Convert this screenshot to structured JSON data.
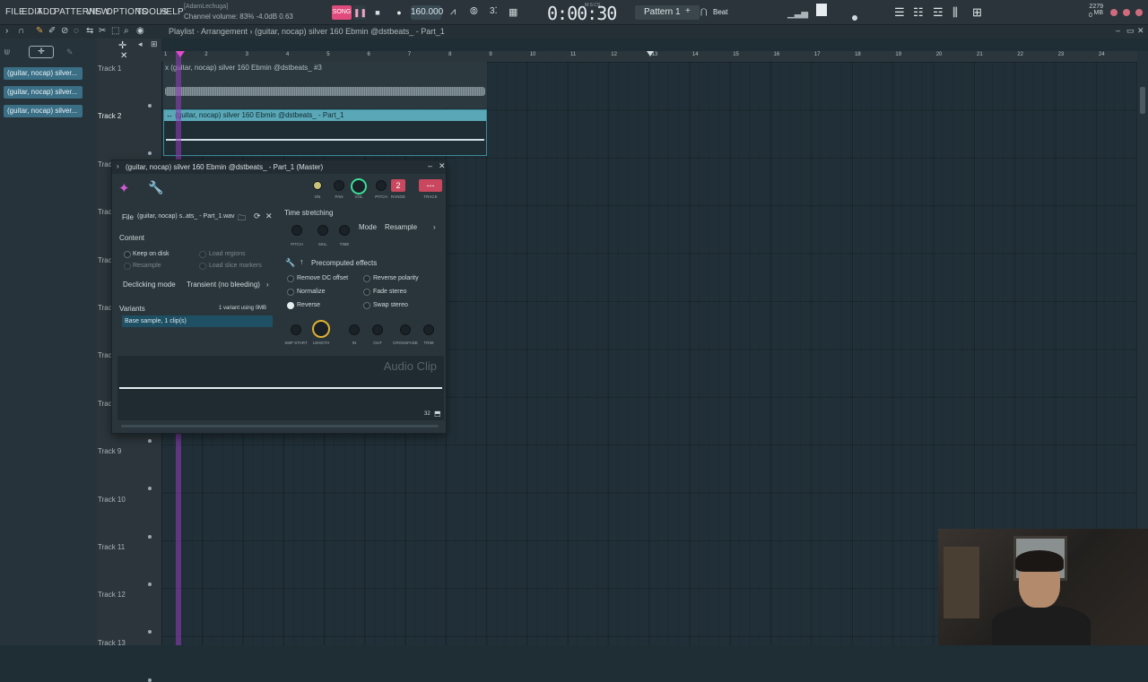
{
  "menu": [
    "FILE",
    "EDIT",
    "ADD",
    "PATTERNS",
    "VIEW",
    "OPTIONS",
    "TOOLS",
    "HELP"
  ],
  "hint": {
    "user": "[AdamLechuga]",
    "line": "Channel volume: 83%  -4.0dB  0.63"
  },
  "transport": {
    "song_label": "SONG",
    "tempo": "160.000",
    "time": "0:00:30",
    "time_unit": "M:S:CS",
    "pattern": "Pattern 1",
    "snap": "Beat"
  },
  "memory": {
    "mb": "2279 MB",
    "cpu": "0"
  },
  "breadcrumb": "Playlist · Arrangement › (guitar, nocap) silver 160 Ebmin @dstbeats_ - Part_1",
  "browser_items": [
    "(guitar, nocap) silver...",
    "(guitar, nocap) silver...",
    "(guitar, nocap) silver..."
  ],
  "tracks": [
    {
      "label": "Track 1"
    },
    {
      "label": "Track 2"
    },
    {
      "label": "Track 3"
    },
    {
      "label": "Track 4"
    },
    {
      "label": "Track 5"
    },
    {
      "label": "Track 6"
    },
    {
      "label": "Track 7"
    },
    {
      "label": "Track 8"
    },
    {
      "label": "Track 9"
    },
    {
      "label": "Track 10"
    },
    {
      "label": "Track 11"
    },
    {
      "label": "Track 12"
    },
    {
      "label": "Track 13"
    }
  ],
  "ruler_ticks": [
    "1",
    "2",
    "3",
    "4",
    "5",
    "6",
    "7",
    "8",
    "9",
    "10",
    "11",
    "12",
    "13",
    "14",
    "15",
    "16",
    "17",
    "18",
    "19",
    "20",
    "21",
    "22",
    "23",
    "24"
  ],
  "clips": {
    "clip1_title": "x (guitar, nocap) silver 160 Ebmin @dstbeats_ #3",
    "clip2_title": "↔ (guitar, nocap) silver 160 Ebmin @dstbeats_ - Part_1"
  },
  "channel": {
    "title": "(guitar, nocap) silver 160 Ebmin @dstbeats_ - Part_1 (Master)",
    "knobs": {
      "on": "ON",
      "pan": "PAN",
      "vol": "VOL",
      "pitch": "PITCH",
      "range": "RANGE",
      "range_value": "2",
      "track": "TRACK",
      "track_value": "---"
    },
    "file_label": "File",
    "file_name": "(guitar, nocap) s..ats_ - Part_1.wav",
    "content_label": "Content",
    "keep_on_disk": "Keep on disk",
    "resample": "Resample",
    "load_regions": "Load regions",
    "load_slice_markers": "Load slice markers",
    "declicking_label": "Declicking mode",
    "declicking_value": "Transient (no bleeding)",
    "variants_label": "Variants",
    "variants_info": "1 variant using 0MB",
    "variant_item": "Base sample, 1 clip(s)",
    "time_stretching": "Time stretching",
    "ts_knobs": [
      "PITCH",
      "MUL",
      "TIME"
    ],
    "mode_label": "Mode",
    "mode_value": "Resample",
    "precomputed": "Precomputed effects",
    "effects": [
      {
        "label": "Remove DC offset",
        "on": false
      },
      {
        "label": "Reverse polarity",
        "on": false
      },
      {
        "label": "Normalize",
        "on": false
      },
      {
        "label": "Fade stereo",
        "on": false
      },
      {
        "label": "Reverse",
        "on": true
      },
      {
        "label": "Swap stereo",
        "on": false
      }
    ],
    "fx_knobs": [
      "SMP START",
      "LENGTH",
      "IN",
      "OUT",
      "CROSSFADE",
      "TRIM"
    ],
    "watermark": "Audio Clip",
    "zoom_value": "32"
  },
  "colors": {
    "accent_pink": "#e04a7c",
    "clip_teal": "#5aa8b7",
    "playhead": "#963cbe"
  }
}
